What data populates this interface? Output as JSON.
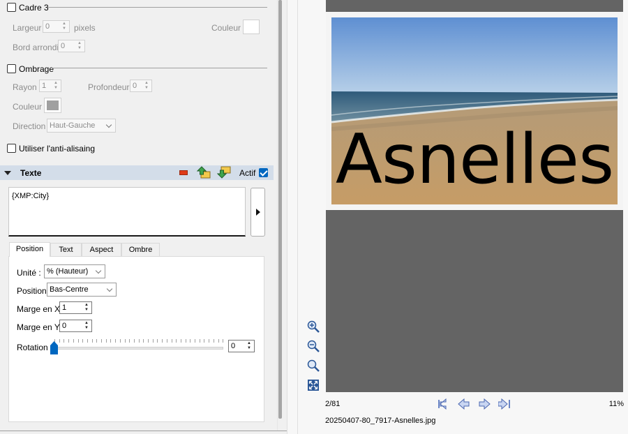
{
  "frame3": {
    "title": "Cadre 3",
    "width_label": "Largeur",
    "width_value": "0",
    "unit": "pixels",
    "color_label": "Couleur",
    "radius_label": "Bord arrondi",
    "radius_value": "0"
  },
  "shadow": {
    "title": "Ombrage",
    "radius_label": "Rayon",
    "radius_value": "1",
    "depth_label": "Profondeur",
    "depth_value": "0",
    "color_label": "Couleur",
    "direction_label": "Direction",
    "direction_value": "Haut-Gauche"
  },
  "antialias": {
    "label": "Utiliser l'anti-alisaing"
  },
  "text_section": {
    "title": "Texte",
    "active_label": "Actif",
    "content": "{XMP:City}",
    "tabs": [
      {
        "label": "Position"
      },
      {
        "label": "Text"
      },
      {
        "label": "Aspect"
      },
      {
        "label": "Ombre"
      }
    ],
    "position": {
      "unit_label": "Unité :",
      "unit_value": "% (Hauteur)",
      "position_label": "Position",
      "position_value": "Bas-Centre",
      "margin_x_label": "Marge en X",
      "margin_x_value": "1",
      "margin_y_label": "Marge en Y",
      "margin_y_value": "0",
      "rotation_label": "Rotation",
      "rotation_value": "0"
    }
  },
  "preview": {
    "overlay_text": "Asnelles",
    "page_indicator": "2/81",
    "zoom": "11%",
    "filename": "20250407-80_7917-Asnelles.jpg"
  },
  "colors": {
    "accent": "#0067c0",
    "section_header": "#d3dde9",
    "preview_page": "#646464",
    "shadow_color": "#a0a0a0"
  }
}
